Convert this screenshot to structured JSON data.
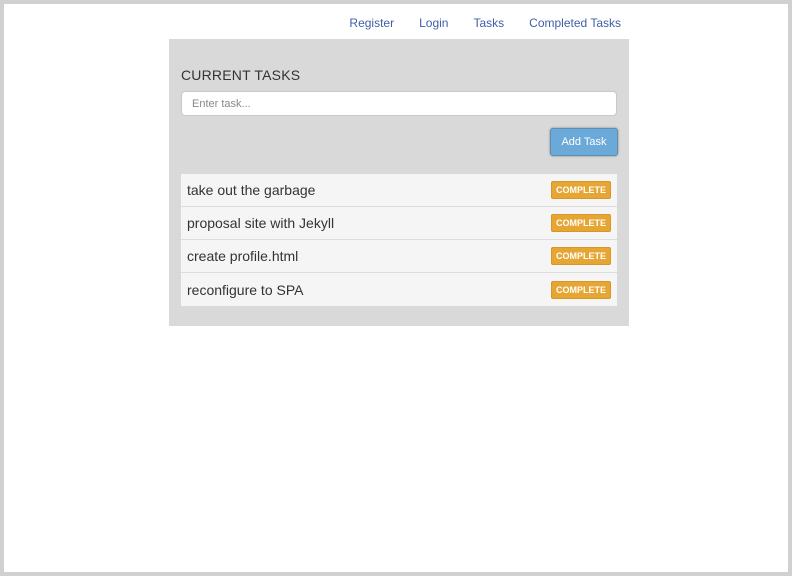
{
  "nav": {
    "register": "Register",
    "login": "Login",
    "tasks": "Tasks",
    "completed_tasks": "Completed Tasks"
  },
  "panel": {
    "title": "CURRENT TASKS",
    "input_placeholder": "Enter task...",
    "input_value": "",
    "add_button_label": "Add Task"
  },
  "tasks": [
    {
      "text": "take out the garbage",
      "action": "COMPLETE"
    },
    {
      "text": "proposal site with Jekyll",
      "action": "COMPLETE"
    },
    {
      "text": "create profile.html",
      "action": "COMPLETE"
    },
    {
      "text": "reconfigure to SPA",
      "action": "COMPLETE"
    }
  ],
  "colors": {
    "link": "#3f5fa8",
    "panel_bg": "#d9d9d9",
    "add_button": "#6aa9d8",
    "complete_button": "#e5a634"
  }
}
